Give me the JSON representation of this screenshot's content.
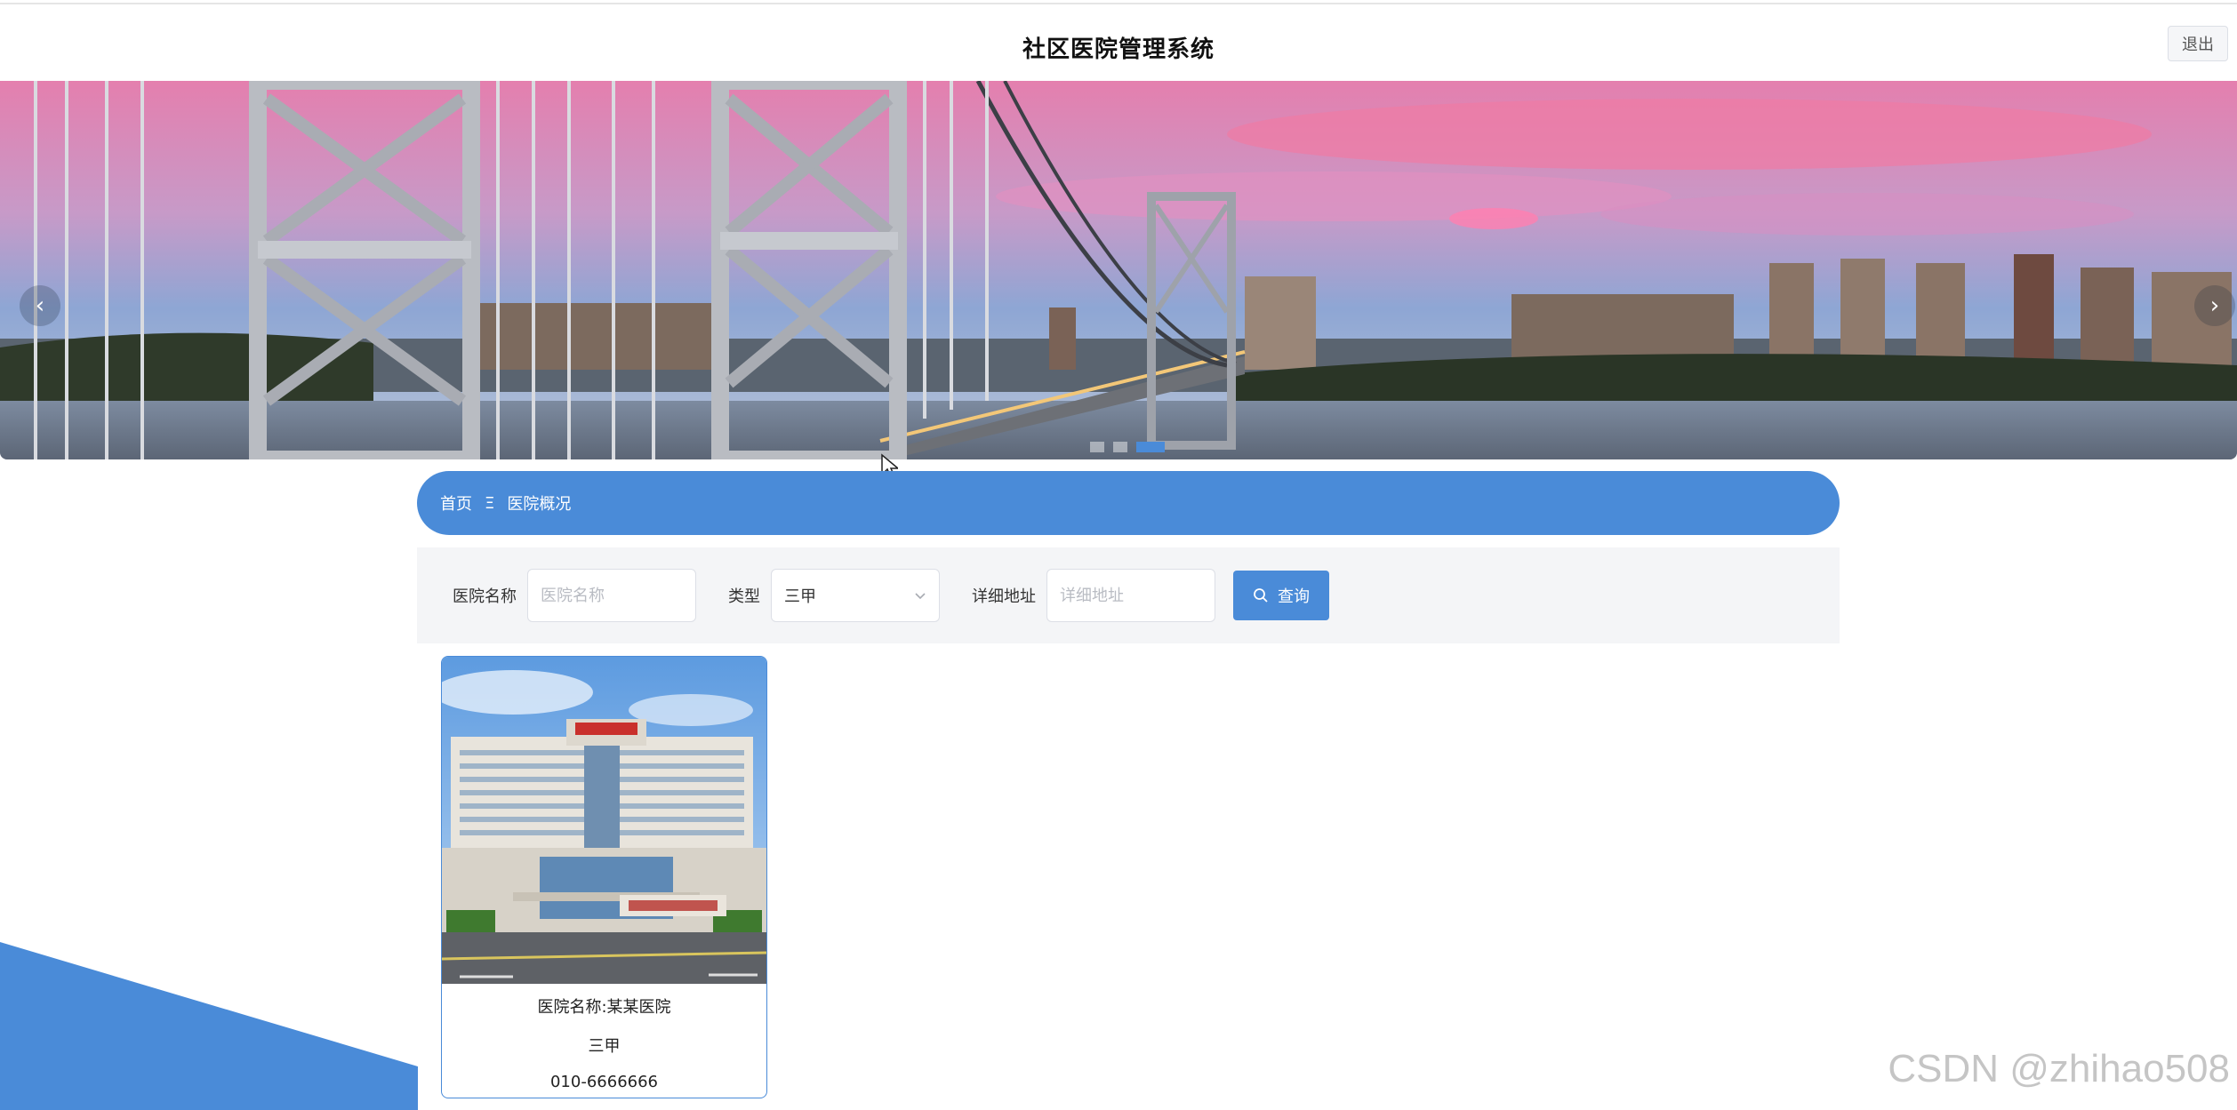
{
  "header": {
    "title": "社区医院管理系统",
    "logout_label": "退出"
  },
  "carousel": {
    "prev_label": "‹",
    "next_label": "›",
    "slide_count": 3,
    "active_index": 2
  },
  "breadcrumb": {
    "home": "首页",
    "separator": "Ξ",
    "current": "医院概况"
  },
  "search": {
    "name_label": "医院名称",
    "name_placeholder": "医院名称",
    "type_label": "类型",
    "type_value": "三甲",
    "address_label": "详细地址",
    "address_placeholder": "详细地址",
    "submit_label": "查询"
  },
  "hospitals": [
    {
      "name_line": "医院名称:某某医院",
      "type": "三甲",
      "phone": "010-6666666"
    }
  ],
  "watermark": "CSDN @zhihao508",
  "colors": {
    "accent": "#4a8bd8",
    "search_bg": "#f4f5f7"
  }
}
